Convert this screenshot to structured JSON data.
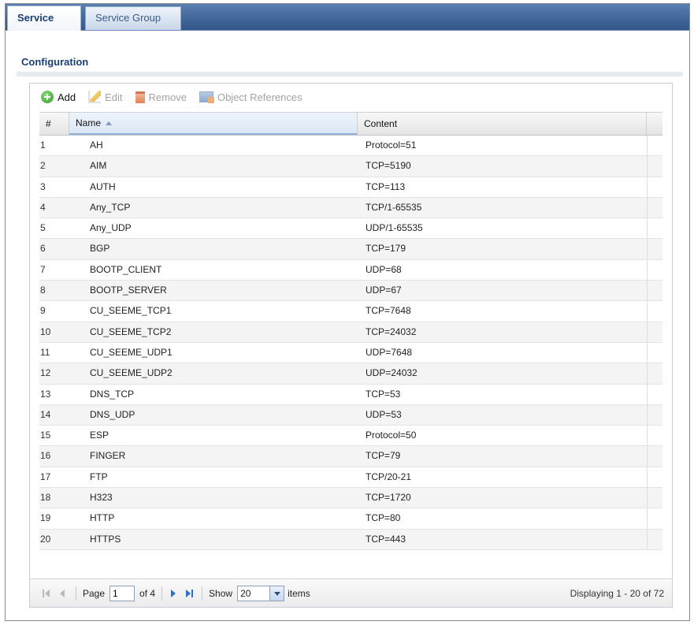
{
  "tabs": [
    {
      "label": "Service",
      "active": true
    },
    {
      "label": "Service Group",
      "active": false
    }
  ],
  "section": {
    "title": "Configuration"
  },
  "toolbar": {
    "add_label": "Add",
    "edit_label": "Edit",
    "remove_label": "Remove",
    "references_label": "Object References"
  },
  "table": {
    "columns": [
      "#",
      "Name",
      "Content"
    ],
    "sorted_column": "Name",
    "rows": [
      {
        "num": "1",
        "name": "AH",
        "content": "Protocol=51"
      },
      {
        "num": "2",
        "name": "AIM",
        "content": "TCP=5190"
      },
      {
        "num": "3",
        "name": "AUTH",
        "content": "TCP=113"
      },
      {
        "num": "4",
        "name": "Any_TCP",
        "content": "TCP/1-65535"
      },
      {
        "num": "5",
        "name": "Any_UDP",
        "content": "UDP/1-65535"
      },
      {
        "num": "6",
        "name": "BGP",
        "content": "TCP=179"
      },
      {
        "num": "7",
        "name": "BOOTP_CLIENT",
        "content": "UDP=68"
      },
      {
        "num": "8",
        "name": "BOOTP_SERVER",
        "content": "UDP=67"
      },
      {
        "num": "9",
        "name": "CU_SEEME_TCP1",
        "content": "TCP=7648"
      },
      {
        "num": "10",
        "name": "CU_SEEME_TCP2",
        "content": "TCP=24032"
      },
      {
        "num": "11",
        "name": "CU_SEEME_UDP1",
        "content": "UDP=7648"
      },
      {
        "num": "12",
        "name": "CU_SEEME_UDP2",
        "content": "UDP=24032"
      },
      {
        "num": "13",
        "name": "DNS_TCP",
        "content": "TCP=53"
      },
      {
        "num": "14",
        "name": "DNS_UDP",
        "content": "UDP=53"
      },
      {
        "num": "15",
        "name": "ESP",
        "content": "Protocol=50"
      },
      {
        "num": "16",
        "name": "FINGER",
        "content": "TCP=79"
      },
      {
        "num": "17",
        "name": "FTP",
        "content": "TCP/20-21"
      },
      {
        "num": "18",
        "name": "H323",
        "content": "TCP=1720"
      },
      {
        "num": "19",
        "name": "HTTP",
        "content": "TCP=80"
      },
      {
        "num": "20",
        "name": "HTTPS",
        "content": "TCP=443"
      }
    ]
  },
  "pager": {
    "page_label": "Page",
    "current_page": "1",
    "of_label": "of 4",
    "show_label": "Show",
    "page_size": "20",
    "items_label": "items",
    "display_info": "Displaying 1 - 20 of 72"
  }
}
